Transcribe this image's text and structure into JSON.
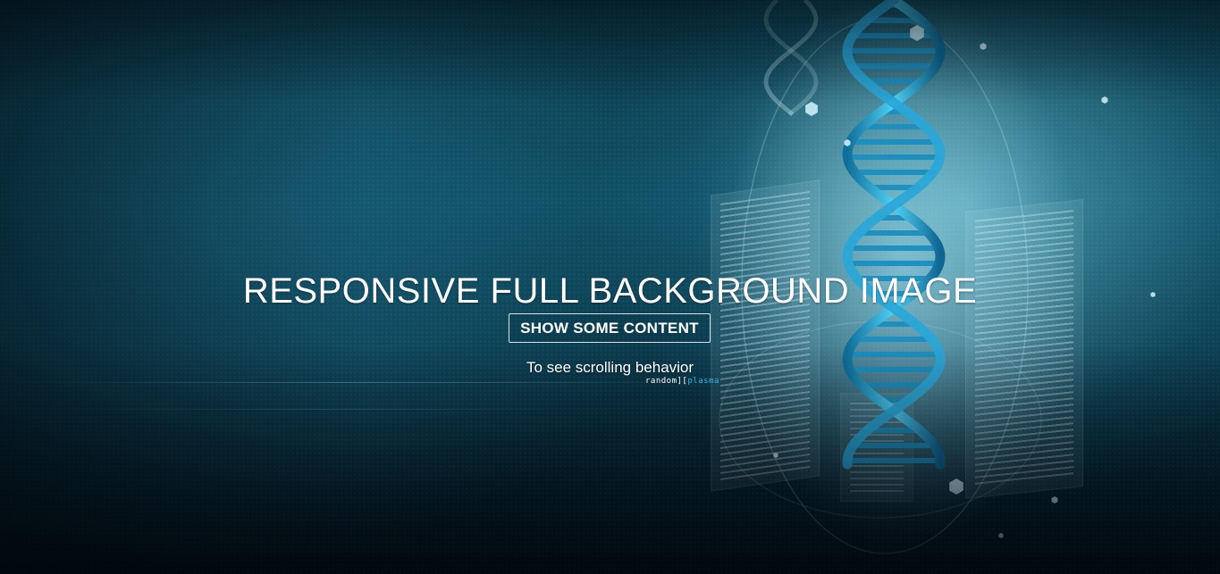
{
  "hero": {
    "title": "RESPONSIVE FULL BACKGROUND IMAGE",
    "button_label": "SHOW SOME CONTENT",
    "subtitle": "To see scrolling behavior"
  },
  "credit": {
    "part1": "random",
    "separator": "][",
    "part2": "plasma"
  },
  "background": {
    "subject": "dna-double-helix",
    "accent": "#1aa4d8",
    "base": "#0b3a4a"
  }
}
